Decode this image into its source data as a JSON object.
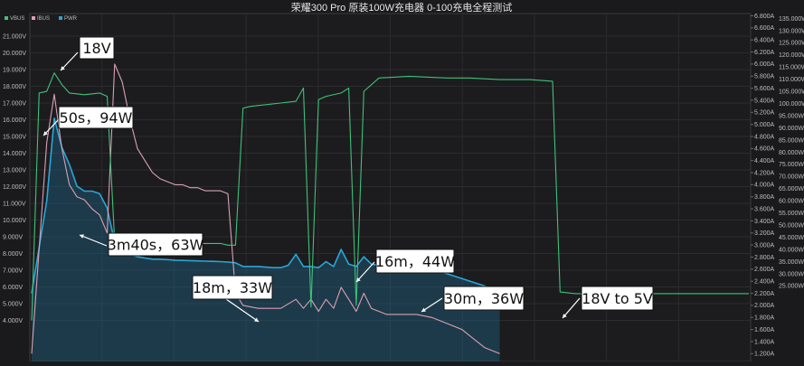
{
  "chart_data": {
    "type": "line",
    "title": "荣耀300 Pro 原装100W充电器 0-100充电全程测试",
    "legend": [
      {
        "name": "VBUS",
        "color": "#3ec27a"
      },
      {
        "name": "IBUS",
        "color": "#d9a0b4"
      },
      {
        "name": "PWR",
        "color": "#2aa6d8"
      }
    ],
    "y_left": {
      "ticks": [
        "21.000V",
        "20.000V",
        "19.000V",
        "18.000V",
        "17.000V",
        "16.000V",
        "15.000V",
        "14.000V",
        "13.000V",
        "12.000V",
        "11.000V",
        "10.000V",
        "9.000V",
        "8.000V",
        "7.000V",
        "6.000V",
        "5.000V",
        "4.000V"
      ],
      "range": [
        4.0,
        21.0
      ]
    },
    "y_right_current": {
      "ticks": [
        "6.800A",
        "6.600A",
        "6.400A",
        "6.200A",
        "6.000A",
        "5.800A",
        "5.600A",
        "5.400A",
        "5.200A",
        "5.000A",
        "4.800A",
        "4.600A",
        "4.400A",
        "4.200A",
        "4.000A",
        "3.800A",
        "3.600A",
        "3.400A",
        "3.200A",
        "3.000A",
        "2.800A",
        "2.600A",
        "2.400A",
        "2.200A",
        "2.000A",
        "1.800A",
        "1.600A",
        "1.400A",
        "1.200A"
      ],
      "range": [
        1.2,
        6.8
      ]
    },
    "y_right_power": {
      "ticks": [
        "135.000W",
        "130.000W",
        "125.000W",
        "120.000W",
        "115.000W",
        "110.000W",
        "105.000W",
        "100.000W",
        "95.000W",
        "90.000W",
        "85.000W",
        "80.000W",
        "75.000W",
        "70.000W",
        "65.000W",
        "60.000W",
        "55.000W",
        "50.000W",
        "45.000W",
        "40.000W",
        "35.000W",
        "30.000W",
        "25.000W"
      ],
      "range": [
        22.0,
        135.0
      ]
    },
    "series": [
      {
        "name": "VBUS",
        "points": [
          [
            0,
            4.0
          ],
          [
            1,
            17.6
          ],
          [
            2,
            17.7
          ],
          [
            3,
            18.8
          ],
          [
            4,
            18.1
          ],
          [
            5,
            17.6
          ],
          [
            7,
            17.5
          ],
          [
            9,
            17.6
          ],
          [
            10,
            17.4
          ],
          [
            11,
            8.7
          ],
          [
            12,
            8.7
          ],
          [
            13,
            8.6
          ],
          [
            15,
            8.6
          ],
          [
            16,
            8.6
          ],
          [
            17,
            8.6
          ],
          [
            18,
            8.6
          ],
          [
            19,
            8.6
          ],
          [
            20,
            8.6
          ],
          [
            21,
            8.6
          ],
          [
            22,
            8.6
          ],
          [
            23,
            8.6
          ],
          [
            24,
            8.6
          ],
          [
            25,
            8.6
          ],
          [
            26,
            8.5
          ],
          [
            27,
            8.5
          ],
          [
            28,
            16.7
          ],
          [
            29,
            16.8
          ],
          [
            33,
            17.0
          ],
          [
            35,
            17.1
          ],
          [
            36,
            17.9
          ],
          [
            37,
            4.8
          ],
          [
            38,
            17.2
          ],
          [
            39,
            17.4
          ],
          [
            41,
            17.6
          ],
          [
            42,
            17.9
          ],
          [
            43,
            4.9
          ],
          [
            44,
            17.7
          ],
          [
            46,
            18.5
          ],
          [
            50,
            18.6
          ],
          [
            55,
            18.5
          ],
          [
            58,
            18.5
          ],
          [
            62,
            18.4
          ],
          [
            66,
            18.4
          ],
          [
            69,
            18.3
          ],
          [
            70,
            5.7
          ],
          [
            72,
            5.6
          ],
          [
            75,
            5.6
          ],
          [
            78,
            5.6
          ],
          [
            82,
            5.6
          ],
          [
            86,
            5.6
          ],
          [
            90,
            5.6
          ],
          [
            94,
            5.6
          ],
          [
            95,
            5.6
          ]
        ]
      },
      {
        "name": "IBUS",
        "points": [
          [
            0,
            1.2
          ],
          [
            2,
            4.7
          ],
          [
            3,
            5.5
          ],
          [
            4,
            4.6
          ],
          [
            5,
            4.0
          ],
          [
            6,
            3.8
          ],
          [
            7,
            3.75
          ],
          [
            8,
            3.6
          ],
          [
            9,
            3.5
          ],
          [
            10,
            3.2
          ],
          [
            11,
            6.0
          ],
          [
            12,
            5.7
          ],
          [
            13,
            5.1
          ],
          [
            14,
            4.6
          ],
          [
            15,
            4.4
          ],
          [
            16,
            4.2
          ],
          [
            17,
            4.1
          ],
          [
            18,
            4.05
          ],
          [
            19,
            4.0
          ],
          [
            20,
            4.0
          ],
          [
            21,
            3.95
          ],
          [
            22,
            3.95
          ],
          [
            23,
            3.9
          ],
          [
            24,
            3.9
          ],
          [
            25,
            3.9
          ],
          [
            26,
            3.85
          ],
          [
            27,
            2.2
          ],
          [
            28,
            2.0
          ],
          [
            30,
            1.95
          ],
          [
            33,
            1.95
          ],
          [
            35,
            2.1
          ],
          [
            36,
            1.95
          ],
          [
            37,
            2.1
          ],
          [
            38,
            1.9
          ],
          [
            39,
            2.1
          ],
          [
            40,
            1.95
          ],
          [
            41,
            2.3
          ],
          [
            42,
            2.1
          ],
          [
            43,
            1.9
          ],
          [
            44,
            2.2
          ],
          [
            45,
            1.95
          ],
          [
            47,
            1.85
          ],
          [
            49,
            1.85
          ],
          [
            51,
            1.85
          ],
          [
            53,
            1.8
          ],
          [
            55,
            1.7
          ],
          [
            57,
            1.6
          ],
          [
            58,
            1.5
          ],
          [
            60,
            1.3
          ],
          [
            62,
            1.2
          ]
        ]
      },
      {
        "name": "PWR",
        "points": [
          [
            0,
            22
          ],
          [
            2,
            60
          ],
          [
            3,
            94
          ],
          [
            4,
            82
          ],
          [
            5,
            75
          ],
          [
            6,
            66
          ],
          [
            7,
            64
          ],
          [
            8,
            64
          ],
          [
            9,
            63
          ],
          [
            10,
            57
          ],
          [
            11,
            43
          ],
          [
            12,
            39
          ],
          [
            13,
            38
          ],
          [
            14,
            37
          ],
          [
            15,
            36.5
          ],
          [
            16,
            36
          ],
          [
            17,
            36
          ],
          [
            18,
            35.8
          ],
          [
            19,
            35.6
          ],
          [
            20,
            35.5
          ],
          [
            21,
            35.4
          ],
          [
            22,
            35.3
          ],
          [
            23,
            35.2
          ],
          [
            24,
            35.1
          ],
          [
            25,
            35
          ],
          [
            26,
            34.8
          ],
          [
            27,
            34.5
          ],
          [
            28,
            33
          ],
          [
            29,
            33
          ],
          [
            30,
            33
          ],
          [
            32,
            32.5
          ],
          [
            33,
            32.5
          ],
          [
            34,
            33.5
          ],
          [
            35,
            38
          ],
          [
            36,
            33
          ],
          [
            37,
            33
          ],
          [
            38,
            32.5
          ],
          [
            39,
            35
          ],
          [
            40,
            33
          ],
          [
            41,
            40
          ],
          [
            42,
            34
          ],
          [
            43,
            33
          ],
          [
            44,
            37
          ],
          [
            45,
            34
          ],
          [
            47,
            33
          ],
          [
            49,
            33
          ],
          [
            51,
            32.5
          ],
          [
            53,
            32
          ],
          [
            55,
            30
          ],
          [
            57,
            28
          ],
          [
            58,
            27
          ],
          [
            60,
            25
          ],
          [
            62,
            22
          ]
        ]
      }
    ],
    "annotations": [
      {
        "text": "18V"
      },
      {
        "text": "50s，94W"
      },
      {
        "text": "3m40s，63W"
      },
      {
        "text": "18m，33W"
      },
      {
        "text": "16m，44W"
      },
      {
        "text": "30m，36W"
      },
      {
        "text": "18V to 5V"
      }
    ],
    "grid": true,
    "legend_position": "top-left"
  }
}
